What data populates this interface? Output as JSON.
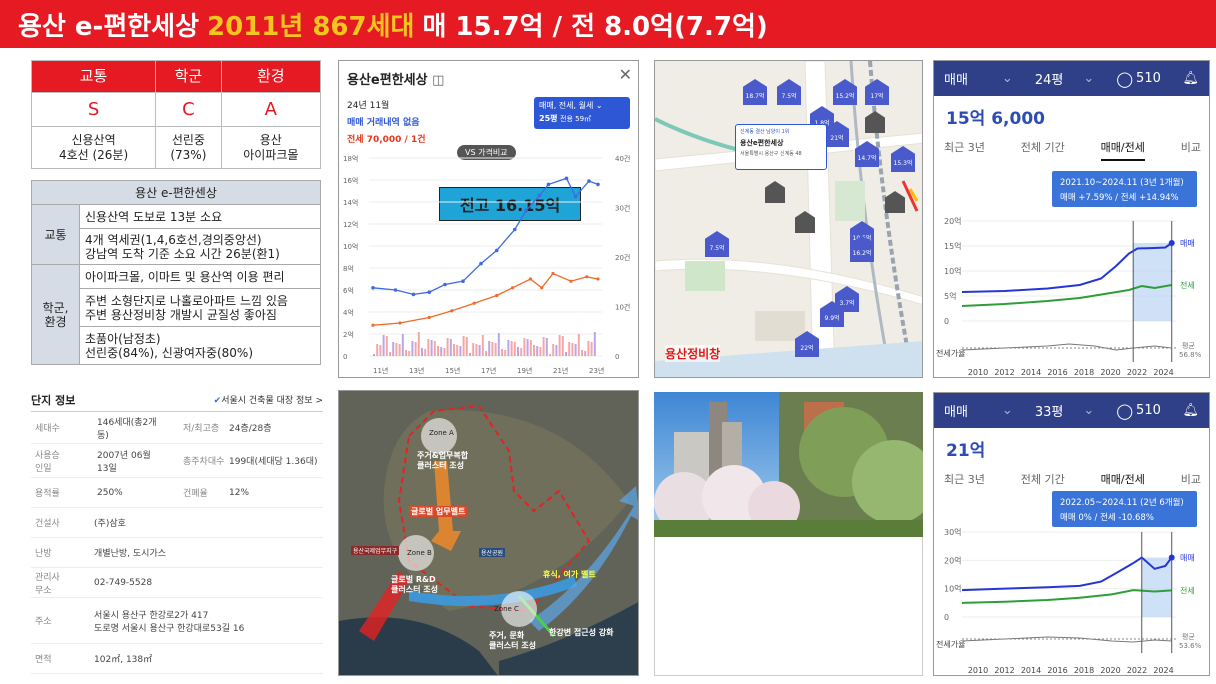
{
  "header": {
    "part1": "용산 e-편한세상",
    "part2": "2011년 867세대",
    "part3": "매 15.7억 / 전 8.0억(7.7억)"
  },
  "grades": {
    "headers": [
      "교통",
      "학군",
      "환경"
    ],
    "grades": [
      "S",
      "C",
      "A"
    ],
    "details": [
      [
        "신용산역",
        "4호선 (26분)"
      ],
      [
        "선린중",
        "(73%)"
      ],
      [
        "용산",
        "아이파크몰"
      ]
    ]
  },
  "summary": {
    "title": "용산 e-편한센상",
    "groups": [
      {
        "cat": "교통",
        "items": [
          "신용산역 도보로 13분 소요",
          "4개 역세권(1,4,6호선,경의중앙선)\n강남역 도착 기준 소요 시간 26분(환1)"
        ]
      },
      {
        "cat": "학군,\n환경",
        "items": [
          "아이파크몰, 이마트 및 용산역 이용 편리",
          "주변 소형단지로 나홀로아파트 느낌 있음\n주변 용산정비창 개발시 균질성 좋아짐",
          "초품아(남정초)\n선린중(84%), 신광여자중(80%)"
        ]
      }
    ]
  },
  "complex": {
    "title": "단지 정보",
    "link": "서울시 건축물 대장 정보 >",
    "rows": [
      [
        "세대수",
        "146세대(총2개동)",
        "저/최고층",
        "24층/28층"
      ],
      [
        "사용승인일",
        "2007년 06월 13일",
        "총주차대수",
        "199대(세대당 1.36대)"
      ],
      [
        "용적률",
        "250%",
        "건폐율",
        "12%"
      ],
      [
        "건설사",
        "(주)삼호",
        "",
        ""
      ],
      [
        "난방",
        "개별난방, 도시가스",
        "",
        ""
      ],
      [
        "관리사무소",
        "02-749-5528",
        "",
        ""
      ],
      [
        "주소",
        "서울시 용산구 한강로2가 417\n도로명 서울시 용산구 한강대로53길 16",
        "",
        ""
      ],
      [
        "면적",
        "102㎡, 138㎡",
        "",
        ""
      ]
    ]
  },
  "chart1": {
    "title": "용산e편한세상",
    "month": "24년 11월",
    "no_trade": "매매 거래내역 없음",
    "jeonse": "전세 70,000 / 1건",
    "filter": "매매, 전세, 월세",
    "size": "25평",
    "size_sub": "전용 59㎡",
    "vs": "VS 가격비교",
    "callout": "전고 16.15억",
    "left_ticks": [
      "18억",
      "16억",
      "14억",
      "12억",
      "10억",
      "8억",
      "6억",
      "4억",
      "2억",
      "0"
    ],
    "right_ticks": [
      "40건",
      "30건",
      "20건",
      "10건",
      "0"
    ],
    "x_ticks": [
      "11년",
      "13년",
      "15년",
      "17년",
      "19년",
      "21년",
      "23년"
    ]
  },
  "map": {
    "popup_small": "신계동 결산 남양이 1위",
    "popup_title": "용산e편한세상",
    "popup_addr": "서울특별시 용산구 신계동 48",
    "redevelop": "용산정비창",
    "markers": [
      "18.7억",
      "7.5억",
      "15.2억",
      "17억",
      "1.8억",
      "21억",
      "14.7억",
      "15.3억",
      "10.5억",
      "7.5억",
      "16.2억",
      "3.7억",
      "9.9억",
      "22억"
    ]
  },
  "aerial": {
    "zone_a": "Zone A",
    "zone_a_desc": "주거&업무복합\n클러스터 조성",
    "global": "글로벌 업무벨트",
    "zone_b": "Zone B",
    "zone_b_desc": "글로벌 R&D\n클러스터 조성",
    "zone_c": "Zone C",
    "zone_c_desc": "주거, 문화\n클러스터 조성",
    "rest": "휴식, 여가 벨트",
    "han": "한강변 접근성 강화",
    "park": "용산공원",
    "intl": "용산국제업무지구"
  },
  "panel24": {
    "type": "매매",
    "size": "24평",
    "count": "510",
    "price": "15억 6,000",
    "tabs": [
      "최근 3년",
      "전체 기간",
      "매매/전세",
      "비교"
    ],
    "tip1": "2021.10~2024.11 (3년 1개월)",
    "tip2": "매매 +7.59% / 전세 +14.94%",
    "y": [
      "20억",
      "15억",
      "10억",
      "5억",
      "0"
    ],
    "years": [
      "2010",
      "2012",
      "2014",
      "2016",
      "2018",
      "2020",
      "2022",
      "2024"
    ],
    "l_sale": "매매",
    "l_jeonse": "전세",
    "l_ratio": "전세가율",
    "avg": "평균",
    "avg_v": "56.8%"
  },
  "panel33": {
    "type": "매매",
    "size": "33평",
    "count": "510",
    "price": "21억",
    "tabs": [
      "최근 3년",
      "전체 기간",
      "매매/전세",
      "비교"
    ],
    "tip1": "2022.05~2024.11 (2년 6개월)",
    "tip2": "매매 0% / 전세 -10.68%",
    "y": [
      "30억",
      "20억",
      "10억",
      "0"
    ],
    "years": [
      "2010",
      "2012",
      "2014",
      "2016",
      "2018",
      "2020",
      "2022",
      "2024"
    ],
    "l_sale": "매매",
    "l_jeonse": "전세",
    "l_ratio": "전세가율",
    "avg": "평균",
    "avg_v": "53.6%"
  },
  "colors": {
    "red": "#e51a23",
    "navy": "#2f3f88",
    "blue": "#2d4cb4",
    "green": "#2f9e3a",
    "gold": "#f3c61f"
  }
}
